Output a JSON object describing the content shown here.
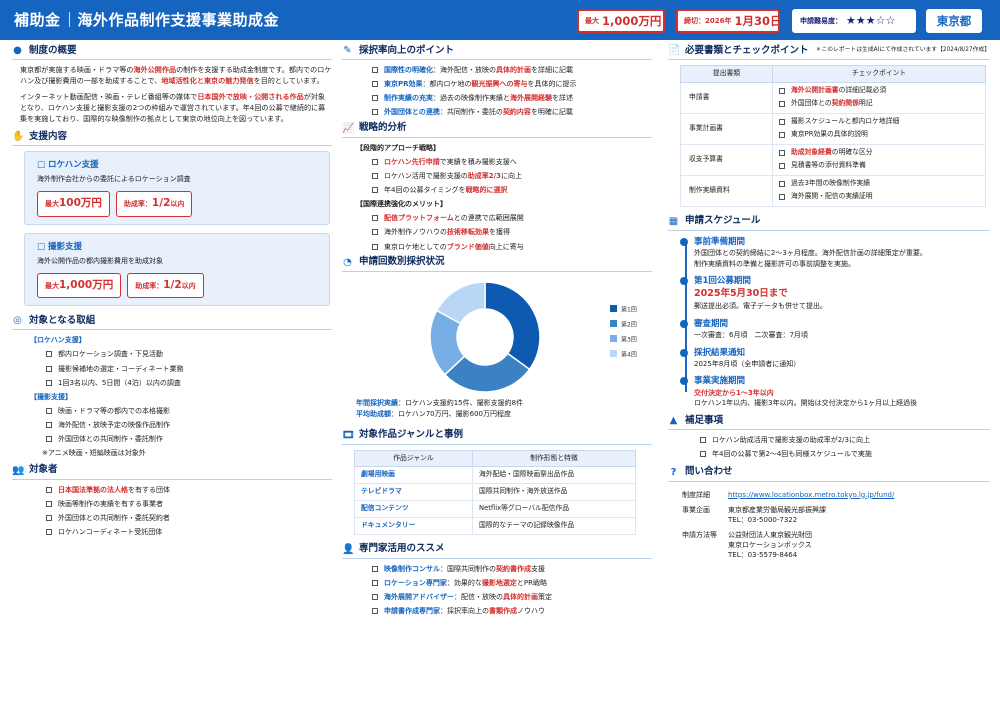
{
  "header": {
    "title_a": "補助金",
    "title_b": "海外作品制作支援事業助成金",
    "max_prefix": "最大",
    "max_value": "1,000万円",
    "deadline_prefix": "締切：",
    "deadline_year": "2026年",
    "deadline_date": "1月30日",
    "difficulty_label": "申請難易度：",
    "difficulty_stars": "★★★☆☆",
    "region": "東京都"
  },
  "notice": "＊このレポートは生成AIにて作成されています【2024/8/27作成】",
  "overview": {
    "heading": "制度の概要",
    "p1_a": "東京都が実施する映画・ドラマ等の",
    "p1_b": "海外公開作品",
    "p1_c": "の制作を支援する助成金制度です。都内でのロケハン及び撮影費用の一部を助成することで、",
    "p1_d": "地域活性化と東京の魅力発信",
    "p1_e": "を目的としています。",
    "p2_a": "インターネット動画配信・映画・テレビ番組等の媒体で",
    "p2_b": "日本国外で放映・公開される作品",
    "p2_c": "が対象となり、ロケハン支援と撮影支援の2つの枠組みで運営されています。年4回の公募で継続的に募集を実施しており、国際的な映像制作の拠点として東京の地位向上を図っています。"
  },
  "support": {
    "heading": "支援内容",
    "cards": [
      {
        "title": "ロケハン支援",
        "desc": "海外制作会社からの委託によるロケーション調査",
        "max_prefix": "最大",
        "max": "100万円",
        "rate_prefix": "助成率：",
        "rate": "1/2",
        "rate_suffix": "以内"
      },
      {
        "title": "撮影支援",
        "desc": "海外公開作品の都内撮影費用を助成対象",
        "max_prefix": "最大",
        "max": "1,000万円",
        "rate_prefix": "助成率：",
        "rate": "1/2",
        "rate_suffix": "以内"
      }
    ]
  },
  "targets": {
    "heading": "対象となる取組",
    "groups": [
      {
        "label": "【ロケハン支援】",
        "items": [
          "都内ロケーション調査・下見活動",
          "撮影候補地の選定・コーディネート業務",
          "1回3名以内、5日間（4泊）以内の調査"
        ]
      },
      {
        "label": "【撮影支援】",
        "items": [
          "映画・ドラマ等の都内での本格撮影",
          "海外配信・放映予定の映像作品制作",
          "外国団体との共同制作・委託制作"
        ]
      }
    ],
    "note": "※アニメ映画・短編映画は対象外"
  },
  "applicants": {
    "heading": "対象者",
    "items": [
      {
        "hl": "日本国法準拠の法人格",
        "rest": "を有する団体"
      },
      {
        "hl": "",
        "rest": "映画等制作の実績を有する事業者"
      },
      {
        "hl": "",
        "rest": "外国団体との共同制作・委託契約者"
      },
      {
        "hl": "",
        "rest": "ロケハンコーディネート受託団体"
      }
    ]
  },
  "points": {
    "heading": "採択率向上のポイント",
    "items": [
      {
        "a": "国際性の明確化",
        "b": "：海外配信・放映の",
        "c": "具体的計画",
        "d": "を詳細に記載"
      },
      {
        "a": "東京PR効果",
        "b": "：都内ロケ地の",
        "c": "観光振興への寄与",
        "d": "を具体的に提示"
      },
      {
        "a": "制作実績の充実",
        "b": "：過去の映像制作実績と",
        "c": "海外展開経験",
        "d": "を詳述"
      },
      {
        "a": "外国団体との連携",
        "b": "：共同制作・委託の",
        "c": "契約内容",
        "d": "を明確に記載"
      }
    ]
  },
  "strategy": {
    "heading": "戦略的分析",
    "groups": [
      {
        "label": "【段階的アプローチ戦略】",
        "items": [
          {
            "a": "",
            "b": "ロケハン先行申請",
            "c": "で実績を積み撮影支援へ"
          },
          {
            "a": "ロケハン活用で撮影支援の",
            "b": "助成率2/3",
            "c": "に向上"
          },
          {
            "a": "年4回の公募タイミングを",
            "b": "戦略的に選択",
            "c": ""
          }
        ]
      },
      {
        "label": "【国際連携強化のメリット】",
        "items": [
          {
            "a": "",
            "b": "配信プラットフォーム",
            "c": "との連携で広範囲展開"
          },
          {
            "a": "海外制作ノウハウの",
            "b": "技術移転効果",
            "c": "を獲得"
          },
          {
            "a": "東京ロケ地としての",
            "b": "ブランド価値",
            "c": "向上に寄与"
          }
        ]
      }
    ]
  },
  "donut": {
    "heading": "申請回数別採択状況",
    "stats": [
      {
        "label": "年間採択実績",
        "value": "：ロケハン支援約15件、撮影支援約8件"
      },
      {
        "label": "平均助成額",
        "value": "：ロケハン70万円、撮影600万円程度"
      }
    ]
  },
  "chart_data": {
    "type": "pie",
    "categories": [
      "第1回",
      "第2回",
      "第3回",
      "第4回"
    ],
    "values": [
      35,
      28,
      20,
      17
    ],
    "colors": [
      "#0d5ab0",
      "#3b82c4",
      "#77aee6",
      "#b9d6f5"
    ],
    "title": "",
    "legend": "right"
  },
  "genres": {
    "heading": "対象作品ジャンルと事例",
    "col1": "作品ジャンル",
    "col2": "制作形態と特徴",
    "rows": [
      {
        "genre": "劇場用映画",
        "desc": "海外配給・国際映画祭出品作品"
      },
      {
        "genre": "テレビドラマ",
        "desc": "国際共同制作・海外放送作品"
      },
      {
        "genre": "配信コンテンツ",
        "desc": "Netflix等グローバル配信作品"
      },
      {
        "genre": "ドキュメンタリー",
        "desc": "国際的なテーマの記録映像作品"
      }
    ]
  },
  "experts": {
    "heading": "専門家活用のススメ",
    "items": [
      {
        "a": "映像制作コンサル",
        "b": "：国際共同制作の",
        "c": "契約書作成",
        "d": "支援"
      },
      {
        "a": "ロケーション専門家",
        "b": "：効果的な",
        "c": "撮影地選定",
        "d": "とPR戦略"
      },
      {
        "a": "海外展開アドバイザー",
        "b": "：配信・放映の",
        "c": "具体的計画",
        "d": "策定"
      },
      {
        "a": "申請書作成専門家",
        "b": "：採択率向上の",
        "c": "書類作成",
        "d": "ノウハウ"
      }
    ]
  },
  "documents": {
    "heading": "必要書類とチェックポイント",
    "col1": "提出書類",
    "col2": "チェックポイント",
    "rows": [
      {
        "cat": "申請書",
        "items": [
          {
            "hl": "海外公開計画書",
            "rest": "の詳細記載必須"
          },
          {
            "hl": "",
            "rest": "外国団体との",
            "hl2": "契約関係",
            "rest2": "明記"
          }
        ]
      },
      {
        "cat": "事業計画書",
        "items": [
          {
            "hl": "",
            "rest": "撮影スケジュールと都内ロケ地詳細"
          },
          {
            "hl": "",
            "rest": "東京PR効果の具体的説明"
          }
        ]
      },
      {
        "cat": "収支予算書",
        "items": [
          {
            "hl": "助成対象経費",
            "rest": "の明確な区分"
          },
          {
            "hl": "",
            "rest": "見積書等の添付資料準備"
          }
        ]
      },
      {
        "cat": "制作実績資料",
        "items": [
          {
            "hl": "",
            "rest": "過去3年間の映像制作実績"
          },
          {
            "hl": "",
            "rest": "海外展開・配信の実績証明"
          }
        ]
      }
    ]
  },
  "schedule": {
    "heading": "申請スケジュール",
    "steps": [
      {
        "title": "事前準備期間",
        "lines": [
          "外国団体との契約締結に2〜3ヶ月程度。海外配信計画の詳細策定が重要。",
          "制作実績資料の準備と撮影許可の事前調整を実施。"
        ],
        "big": "",
        "red": ""
      },
      {
        "title": "第1回公募期間",
        "big": "2025年5月30日まで",
        "lines": [
          "郵送提出必須。電子データも併せて提出。"
        ],
        "red": ""
      },
      {
        "title": "審査期間",
        "lines": [
          "一次審査：6月頃　二次審査：7月頃"
        ],
        "big": "",
        "red": ""
      },
      {
        "title": "採択結果通知",
        "lines": [
          "2025年8月頃（全申請者に通知）"
        ],
        "big": "",
        "red": ""
      },
      {
        "title": "事業実施期間",
        "red": "交付決定から1〜3年以内",
        "lines": [
          "ロケハン1年以内、撮影3年以内。開始は交付決定から1ヶ月以上経過後"
        ],
        "big": ""
      }
    ]
  },
  "supplement": {
    "heading": "補足事項",
    "items": [
      "ロケハン助成活用で撮影支援の助成率が2/3に向上",
      "年4回の公募で第2〜4回も同様スケジュールで実施"
    ]
  },
  "contact": {
    "heading": "問い合わせ",
    "detail_label": "制度詳細",
    "url": "https://www.locationbox.metro.tokyo.lg.jp/fund/",
    "office_label": "事業企画",
    "office_lines": [
      "東京都産業労働局観光部振興課",
      "TEL：03-5000-7322"
    ],
    "apply_label": "申請方法等",
    "apply_lines": [
      "公益財団法人東京観光財団",
      "東京ロケーションボックス",
      "TEL：03-5579-8464"
    ]
  }
}
